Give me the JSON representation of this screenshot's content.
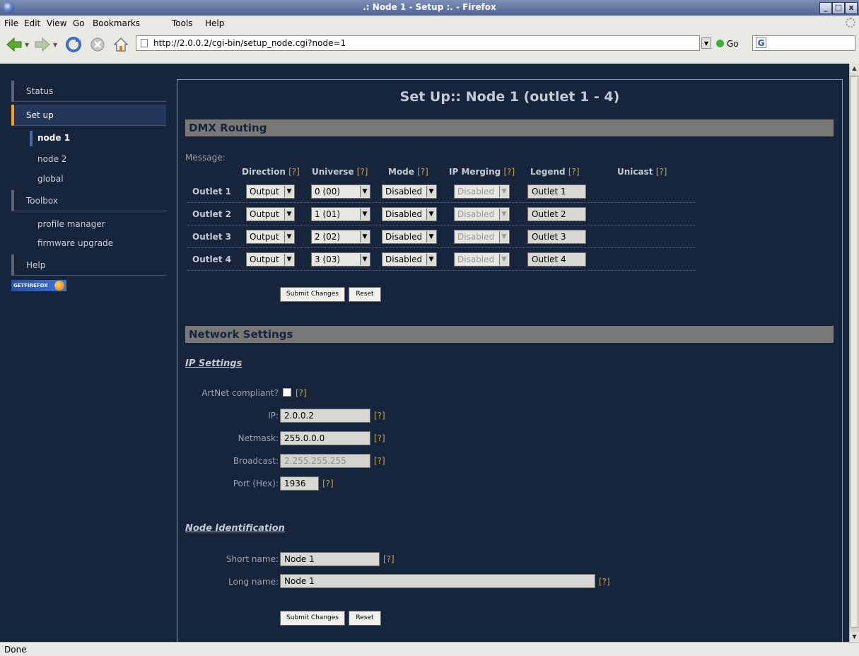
{
  "window": {
    "title": ".: Node 1 - Setup :. - Firefox",
    "minimize": "_",
    "maximize": "□",
    "close": "x"
  },
  "menu": [
    "File",
    "Edit",
    "View",
    "Go",
    "Bookmarks",
    "Tools",
    "Help"
  ],
  "toolbar": {
    "url": "http://2.0.0.2/cgi-bin/setup_node.cgi?node=1",
    "go_label": "Go",
    "search_icon": "G"
  },
  "status": "Done",
  "sidebar": {
    "status": "Status",
    "setup": "Set up",
    "setup_items": [
      "node 1",
      "node 2",
      "global"
    ],
    "toolbox": "Toolbox",
    "toolbox_items": [
      "profile manager",
      "firmware upgrade"
    ],
    "help": "Help",
    "badge": "GETFIREFOX"
  },
  "page": {
    "title": "Set Up:: Node 1 (outlet 1 - 4)",
    "dmx": {
      "heading": "DMX Routing",
      "message_label": "Message:",
      "columns": [
        "Direction",
        "Universe",
        "Mode",
        "IP Merging",
        "Legend",
        "Unicast"
      ],
      "help_mark": "[?]",
      "rows": [
        {
          "label": "Outlet 1",
          "direction": "Output",
          "universe": "0 (00)",
          "mode": "Disabled",
          "ip_merging": "Disabled",
          "legend": "Outlet 1"
        },
        {
          "label": "Outlet 2",
          "direction": "Output",
          "universe": "1 (01)",
          "mode": "Disabled",
          "ip_merging": "Disabled",
          "legend": "Outlet 2"
        },
        {
          "label": "Outlet 3",
          "direction": "Output",
          "universe": "2 (02)",
          "mode": "Disabled",
          "ip_merging": "Disabled",
          "legend": "Outlet 3"
        },
        {
          "label": "Outlet 4",
          "direction": "Output",
          "universe": "3 (03)",
          "mode": "Disabled",
          "ip_merging": "Disabled",
          "legend": "Outlet 4"
        }
      ],
      "submit": "Submit Changes",
      "reset": "Reset"
    },
    "network": {
      "heading": "Network Settings",
      "ip_settings": {
        "heading": "IP Settings",
        "artnet_label": "ArtNet compliant?",
        "artnet_checked": false,
        "ip_label": "IP:",
        "ip": "2.0.0.2",
        "netmask_label": "Netmask:",
        "netmask": "255.0.0.0",
        "broadcast_label": "Broadcast:",
        "broadcast": "2.255.255.255",
        "port_label": "Port (Hex):",
        "port": "1936"
      },
      "node_id": {
        "heading": "Node Identification",
        "short_label": "Short name:",
        "short_name": "Node 1",
        "long_label": "Long name:",
        "long_name": "Node 1"
      },
      "submit": "Submit Changes",
      "reset": "Reset"
    }
  }
}
